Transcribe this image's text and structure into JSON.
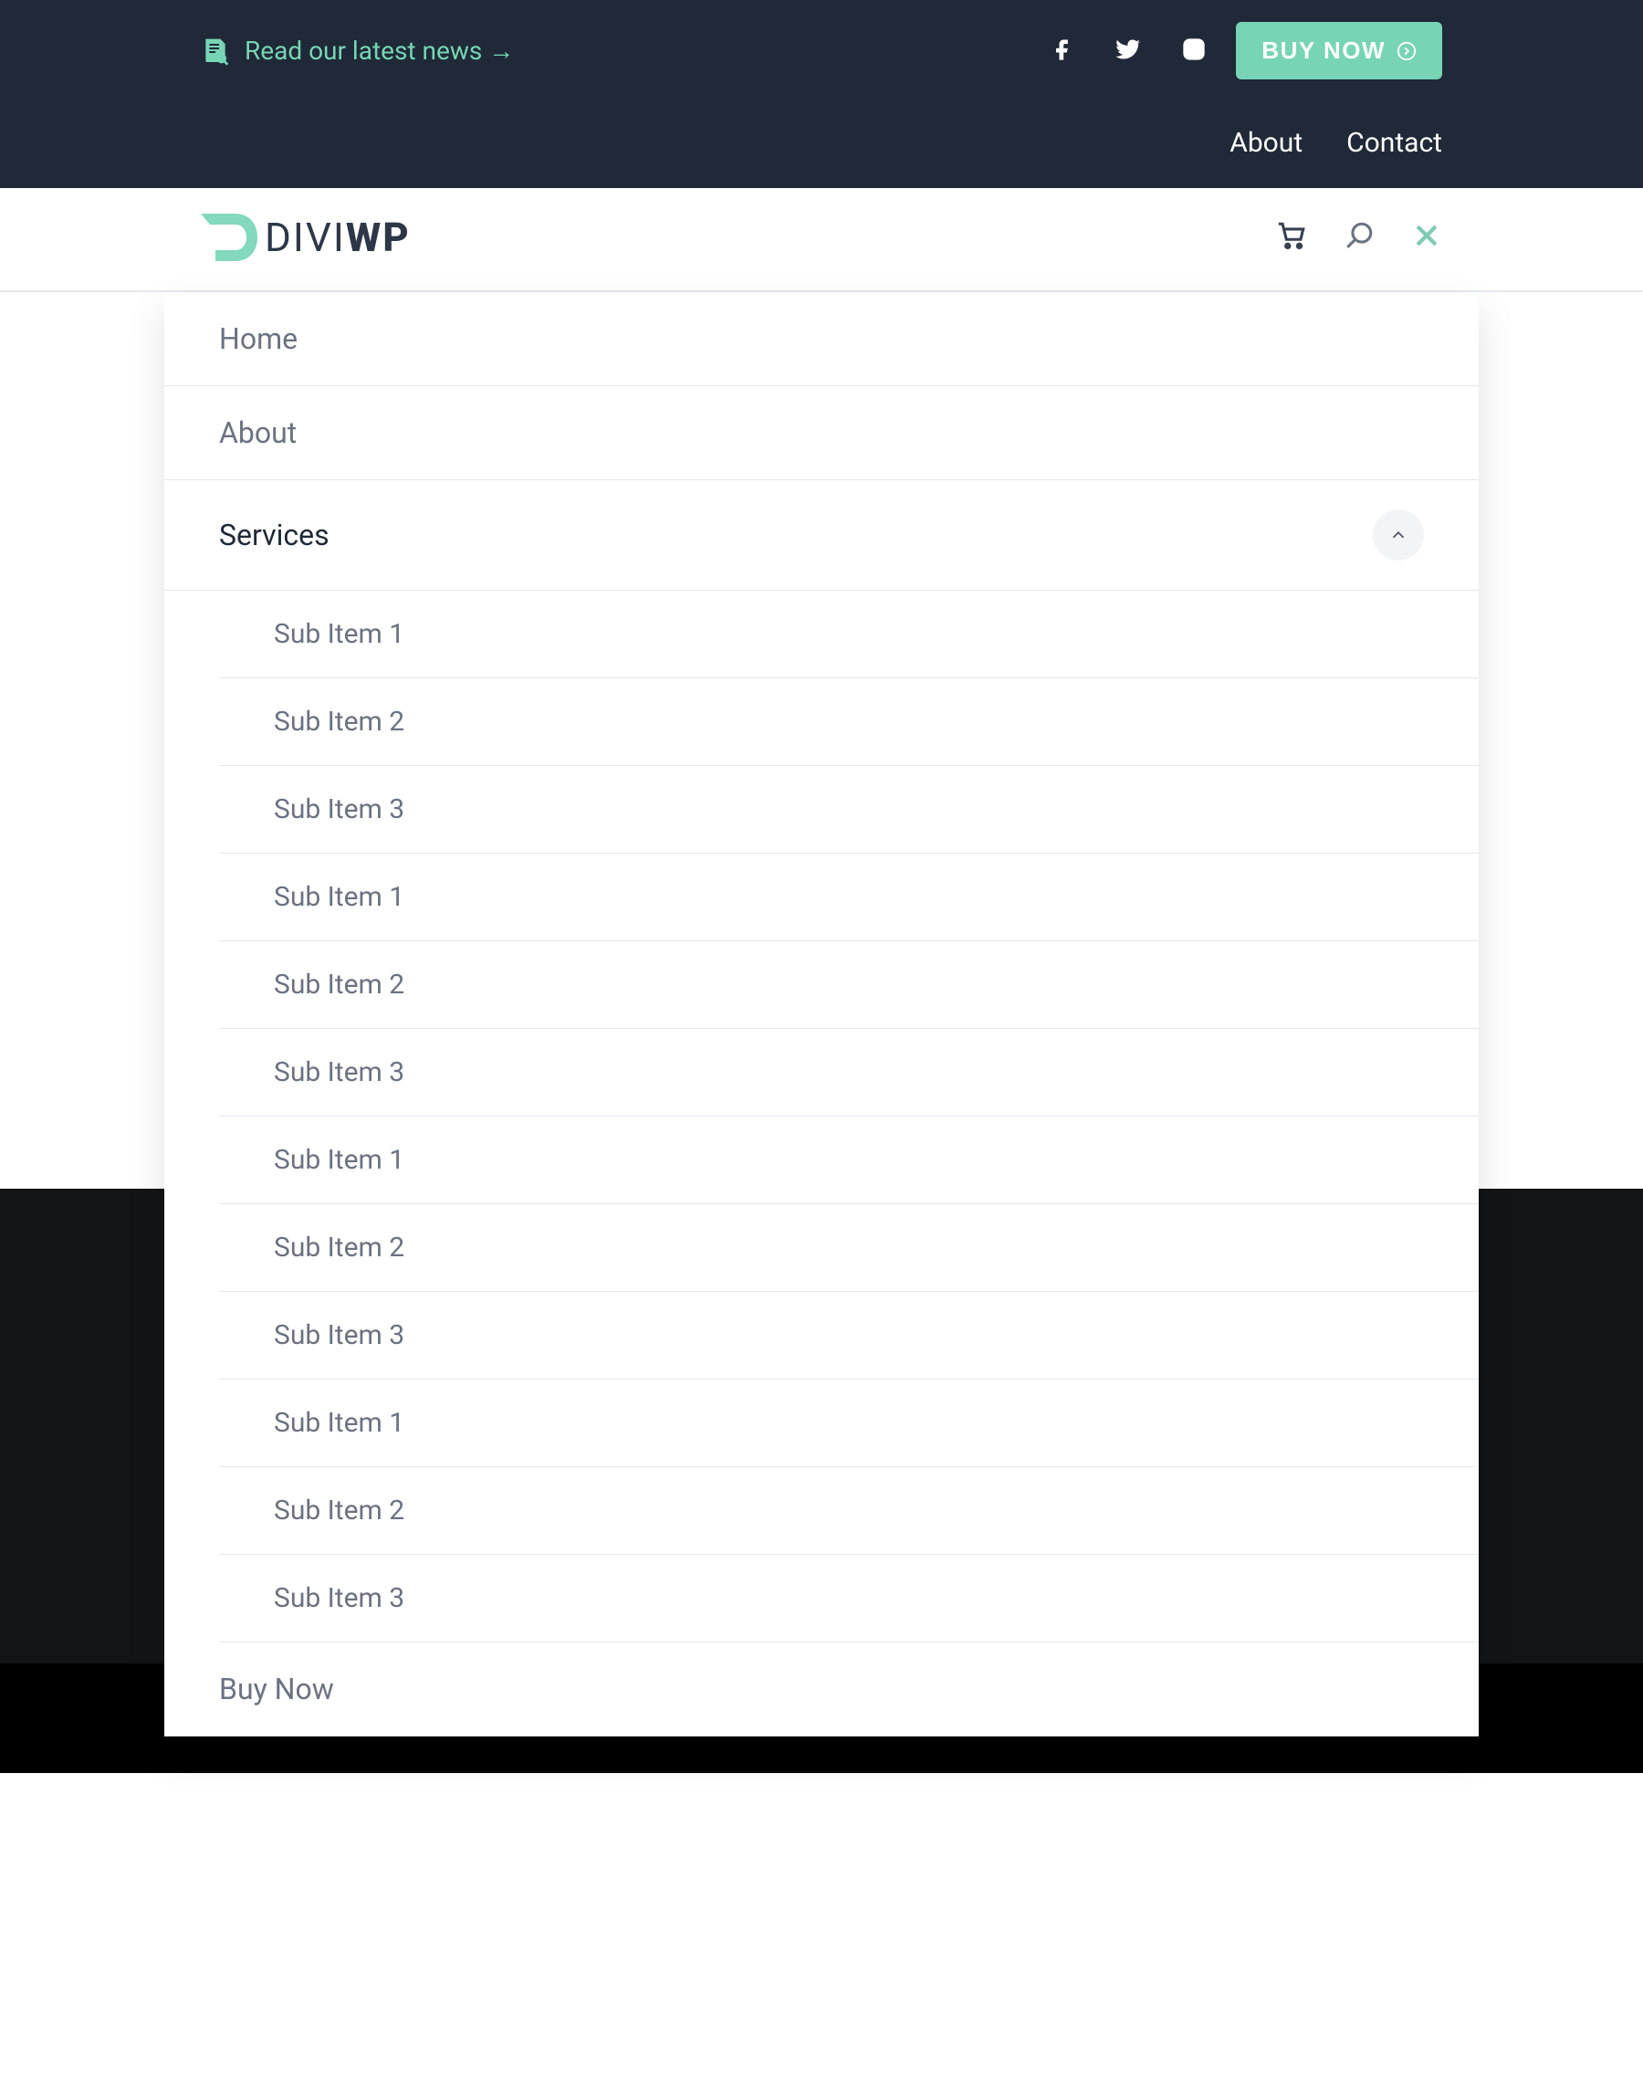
{
  "topbar": {
    "news_label": "Read our latest news →",
    "buy_now_label": "BUY NOW",
    "secondary_links": [
      "About",
      "Contact"
    ]
  },
  "logo": {
    "line1": "DIVI",
    "line2": "WP"
  },
  "menu": {
    "items": [
      {
        "label": "Home",
        "active": false,
        "submenu": []
      },
      {
        "label": "About",
        "active": false,
        "submenu": []
      },
      {
        "label": "Services",
        "active": true,
        "submenu": [
          "Sub Item 1",
          "Sub Item 2",
          "Sub Item 3",
          "Sub Item 1",
          "Sub Item 2",
          "Sub Item 3",
          "Sub Item 1",
          "Sub Item 2",
          "Sub Item 3",
          "Sub Item 1",
          "Sub Item 2",
          "Sub Item 3"
        ]
      },
      {
        "label": "Buy Now",
        "active": false,
        "submenu": []
      }
    ]
  },
  "colors": {
    "brand_teal": "#77d4b4",
    "dark_navy": "#1f2937",
    "text_muted": "#6b7280"
  }
}
